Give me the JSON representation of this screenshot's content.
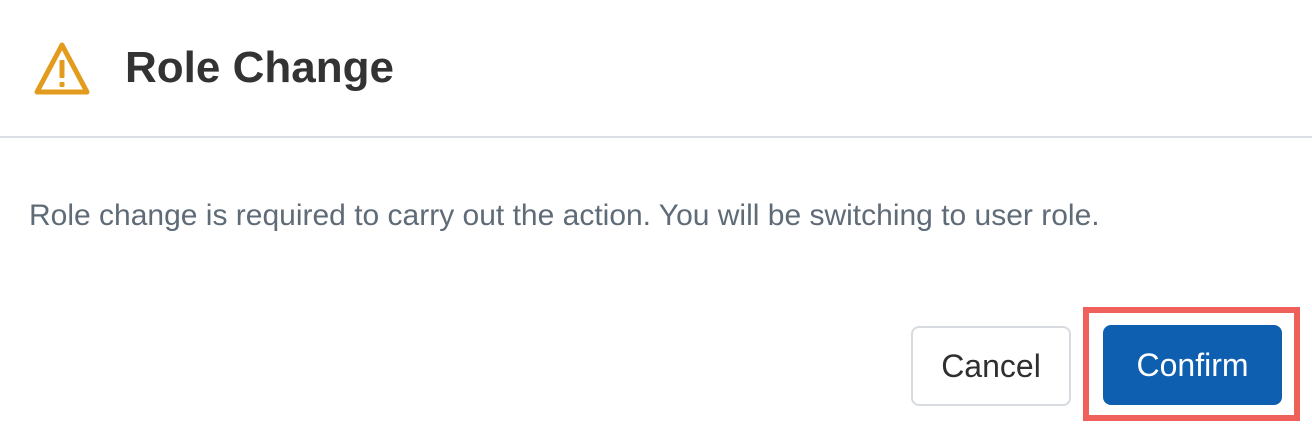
{
  "dialog": {
    "title": "Role Change",
    "icon": "warning-icon",
    "message": "Role change is required to carry out the action. You will be switching to user role.",
    "buttons": {
      "cancel_label": "Cancel",
      "confirm_label": "Confirm"
    }
  },
  "colors": {
    "warning": "#E39B1E",
    "primary": "#0F5FB0",
    "highlight": "#F0605A"
  }
}
